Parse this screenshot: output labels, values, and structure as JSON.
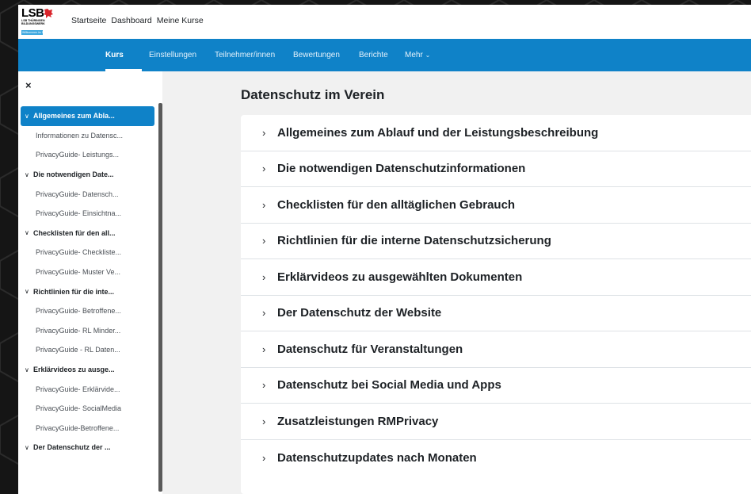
{
  "brand": {
    "logo_text": "LSB",
    "logo_sub": "LSB THÜRINGEN BILDUNGSWERK",
    "logo_badge": "Willkommen im Sport"
  },
  "topnav": {
    "items": [
      "Startseite",
      "Dashboard",
      "Meine Kurse"
    ]
  },
  "secnav": {
    "items": [
      "Kurs",
      "Einstellungen",
      "Teilnehmer/innen",
      "Bewertungen",
      "Berichte",
      "Mehr"
    ],
    "active_index": 0
  },
  "sidebar": {
    "close": "×",
    "items": [
      {
        "label": "Allgemeines zum Abla...",
        "type": "section",
        "active": true
      },
      {
        "label": "Informationen zu Datensc...",
        "type": "sub"
      },
      {
        "label": "PrivacyGuide- Leistungs...",
        "type": "sub"
      },
      {
        "label": "Die notwendigen Date...",
        "type": "section"
      },
      {
        "label": "PrivacyGuide- Datensch...",
        "type": "sub"
      },
      {
        "label": "PrivacyGuide- Einsichtna...",
        "type": "sub"
      },
      {
        "label": "Checklisten für den all...",
        "type": "section"
      },
      {
        "label": "PrivacyGuide- Checkliste...",
        "type": "sub"
      },
      {
        "label": "PrivacyGuide- Muster Ve...",
        "type": "sub"
      },
      {
        "label": "Richtlinien für die inte...",
        "type": "section"
      },
      {
        "label": "PrivacyGuide- Betroffene...",
        "type": "sub"
      },
      {
        "label": "PrivacyGuide- RL Minder...",
        "type": "sub"
      },
      {
        "label": "PrivacyGuide - RL Daten...",
        "type": "sub"
      },
      {
        "label": "Erklärvideos zu ausge...",
        "type": "section"
      },
      {
        "label": "PrivacyGuide- Erklärvide...",
        "type": "sub"
      },
      {
        "label": "PrivacyGuide- SocialMedia",
        "type": "sub"
      },
      {
        "label": "PrivacyGuide-Betroffene...",
        "type": "sub"
      },
      {
        "label": "Der Datenschutz der ...",
        "type": "section"
      }
    ]
  },
  "main": {
    "title": "Datenschutz im Verein",
    "sections": [
      "Allgemeines zum Ablauf und der Leistungsbeschreibung",
      "Die notwendigen Datenschutzinformationen",
      "Checklisten für den alltäglichen Gebrauch",
      "Richtlinien für die interne Datenschutzsicherung",
      "Erklärvideos zu ausgewählten Dokumenten",
      "Der Datenschutz der Website",
      "Datenschutz für Veranstaltungen",
      "Datenschutz bei Social Media und Apps",
      "Zusatzleistungen RMPrivacy",
      "Datenschutzupdates nach Monaten"
    ]
  },
  "colors": {
    "primary": "#0f82c8",
    "page_bg": "#f1f1f1",
    "outer_bg": "#151515"
  }
}
